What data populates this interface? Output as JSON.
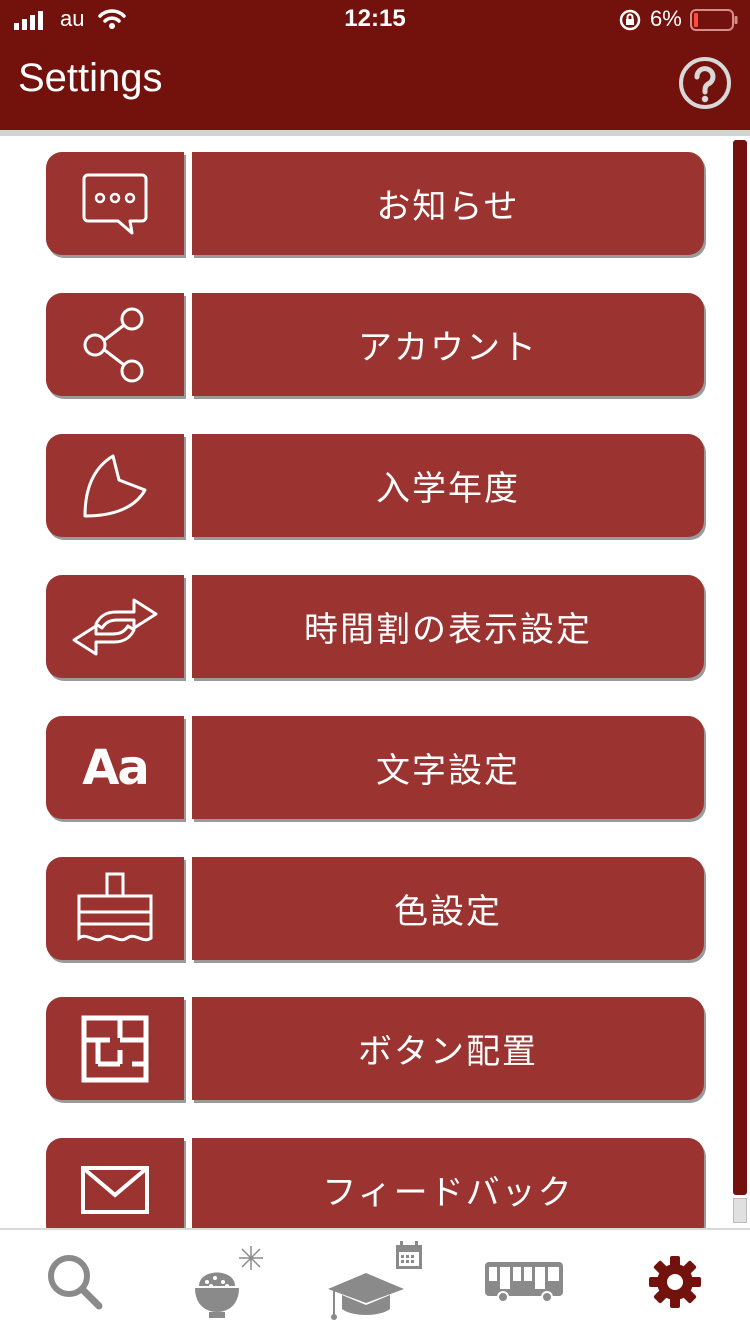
{
  "status_bar": {
    "carrier": "au",
    "time": "12:15",
    "battery": "6%"
  },
  "header": {
    "title": "Settings"
  },
  "menu": [
    {
      "id": "notice",
      "label": "お知らせ",
      "icon": "chat-bubble-icon"
    },
    {
      "id": "account",
      "label": "アカウント",
      "icon": "share-icon"
    },
    {
      "id": "enrollment",
      "label": "入学年度",
      "icon": "leaf-icon"
    },
    {
      "id": "timetable",
      "label": "時間割の表示設定",
      "icon": "swap-arrows-icon"
    },
    {
      "id": "font",
      "label": "文字設定",
      "icon": "font-size-icon",
      "icon_text": "Aa"
    },
    {
      "id": "color",
      "label": "色設定",
      "icon": "paint-brush-icon"
    },
    {
      "id": "layout",
      "label": "ボタン配置",
      "icon": "floor-plan-icon"
    },
    {
      "id": "feedback",
      "label": "フィードバック",
      "icon": "mail-icon"
    }
  ],
  "tabs": [
    {
      "id": "search",
      "icon": "search-icon",
      "active": false
    },
    {
      "id": "food",
      "icon": "rice-bowl-icon",
      "active": false
    },
    {
      "id": "school",
      "icon": "graduation-cap-icon",
      "active": false
    },
    {
      "id": "bus",
      "icon": "bus-icon",
      "active": false
    },
    {
      "id": "settings",
      "icon": "gear-icon",
      "active": true
    }
  ],
  "colors": {
    "header": "#73120c",
    "tile": "#9b3431",
    "tab_inactive": "#8a8a8a",
    "tab_active": "#73120c"
  }
}
